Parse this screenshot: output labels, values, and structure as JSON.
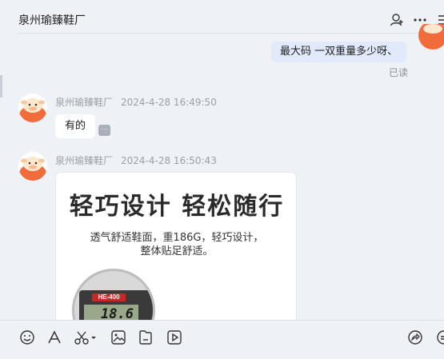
{
  "header": {
    "title": "泉州瑜臻鞋厂"
  },
  "messages": [
    {
      "type": "outgoing",
      "text": "最大码 一双重量多少呀、",
      "status": "已读"
    },
    {
      "type": "incoming",
      "sender": "泉州瑜臻鞋厂",
      "time": "2024-4-28 16:49:50",
      "text": "有的",
      "more": "···"
    },
    {
      "type": "incoming-image",
      "sender": "泉州瑜臻鞋厂",
      "time": "2024-4-28 16:50:43",
      "image": {
        "headline": "轻巧设计 轻松随行",
        "line1": "透气舒适鞋面，重186G，轻巧设计，",
        "line2": "整体贴足舒适。",
        "scale_brand": "HE-400",
        "scale_reading": "18.6"
      }
    }
  ],
  "icons": {
    "header": [
      "add-member-icon",
      "more-icon",
      "sidebar-toggle-icon"
    ],
    "toolbar": [
      "emoji-icon",
      "font-icon",
      "screenshot-icon",
      "image-icon",
      "file-icon",
      "video-icon",
      "share-icon",
      "chat-history-icon"
    ]
  },
  "colors": {
    "background": "#eef1f5",
    "self_bubble": "#e1eafb",
    "avatar_orange": "#f26b3a"
  }
}
